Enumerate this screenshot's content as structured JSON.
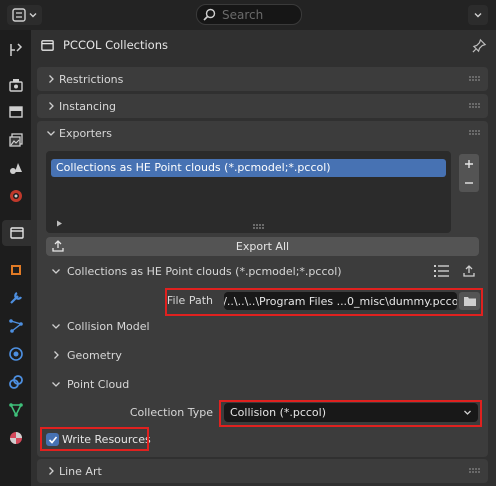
{
  "header": {
    "search_placeholder": "Search",
    "panel_title": "PCCOL Collections"
  },
  "sidebar": {
    "items": [
      "tool-icon",
      "render-icon",
      "output-icon",
      "view-layer-icon",
      "scene-icon",
      "world-icon",
      "collection-icon",
      "object-icon",
      "modifier-icon",
      "particles-icon",
      "physics-icon",
      "constraints-icon",
      "data-icon",
      "material-icon"
    ],
    "active": "collection-icon"
  },
  "panels": {
    "restrictions": "Restrictions",
    "instancing": "Instancing",
    "exporters": "Exporters"
  },
  "exporters": {
    "list_items": [
      "Collections as HE Point clouds (*.pcmodel;*.pccol)"
    ],
    "export_all": "Export All",
    "sub_title": "Collections as HE Point clouds (*.pcmodel;*.pccol)",
    "file_path_label": "File Path",
    "file_path_value": "//..\\..\\..\\Program Files ...0_misc\\dummy.pccol",
    "collision_model": "Collision Model",
    "geometry": "Geometry",
    "point_cloud": "Point Cloud",
    "collection_type_label": "Collection Type",
    "collection_type_value": "Collision (*.pccol)",
    "write_resources_label": "Write Resources",
    "write_resources_checked": true
  },
  "line_art": "Line Art",
  "colors": {
    "highlight_red": "#e0211f",
    "list_selected": "#4772b3",
    "checkbox": "#4772b3"
  }
}
